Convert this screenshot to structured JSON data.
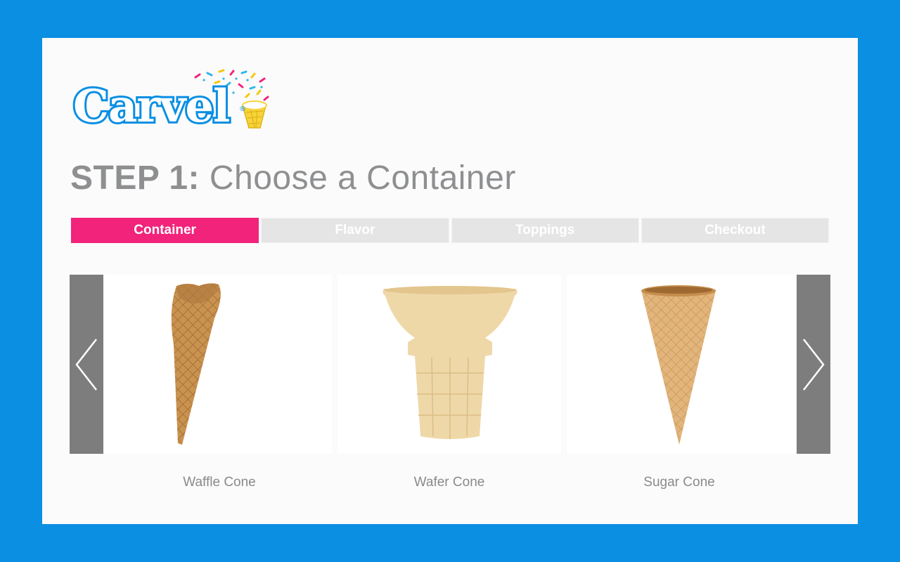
{
  "brand": {
    "logo_text": "Carvel",
    "registered_mark": "®",
    "colors": {
      "logo_blue": "#0a8fe3",
      "accent_pink": "#f1237a",
      "frame_blue": "#0a8fe3"
    }
  },
  "heading": {
    "step_label": "STEP 1:",
    "title": "Choose a Container"
  },
  "steps": [
    {
      "label": "Container",
      "active": true
    },
    {
      "label": "Flavor",
      "active": false
    },
    {
      "label": "Toppings",
      "active": false
    },
    {
      "label": "Checkout",
      "active": false
    }
  ],
  "carousel": {
    "prev_icon": "chevron-left-icon",
    "next_icon": "chevron-right-icon",
    "items": [
      {
        "name": "Waffle Cone",
        "image": "waffle-cone-image"
      },
      {
        "name": "Wafer Cone",
        "image": "wafer-cone-image"
      },
      {
        "name": "Sugar Cone",
        "image": "sugar-cone-image"
      }
    ]
  }
}
